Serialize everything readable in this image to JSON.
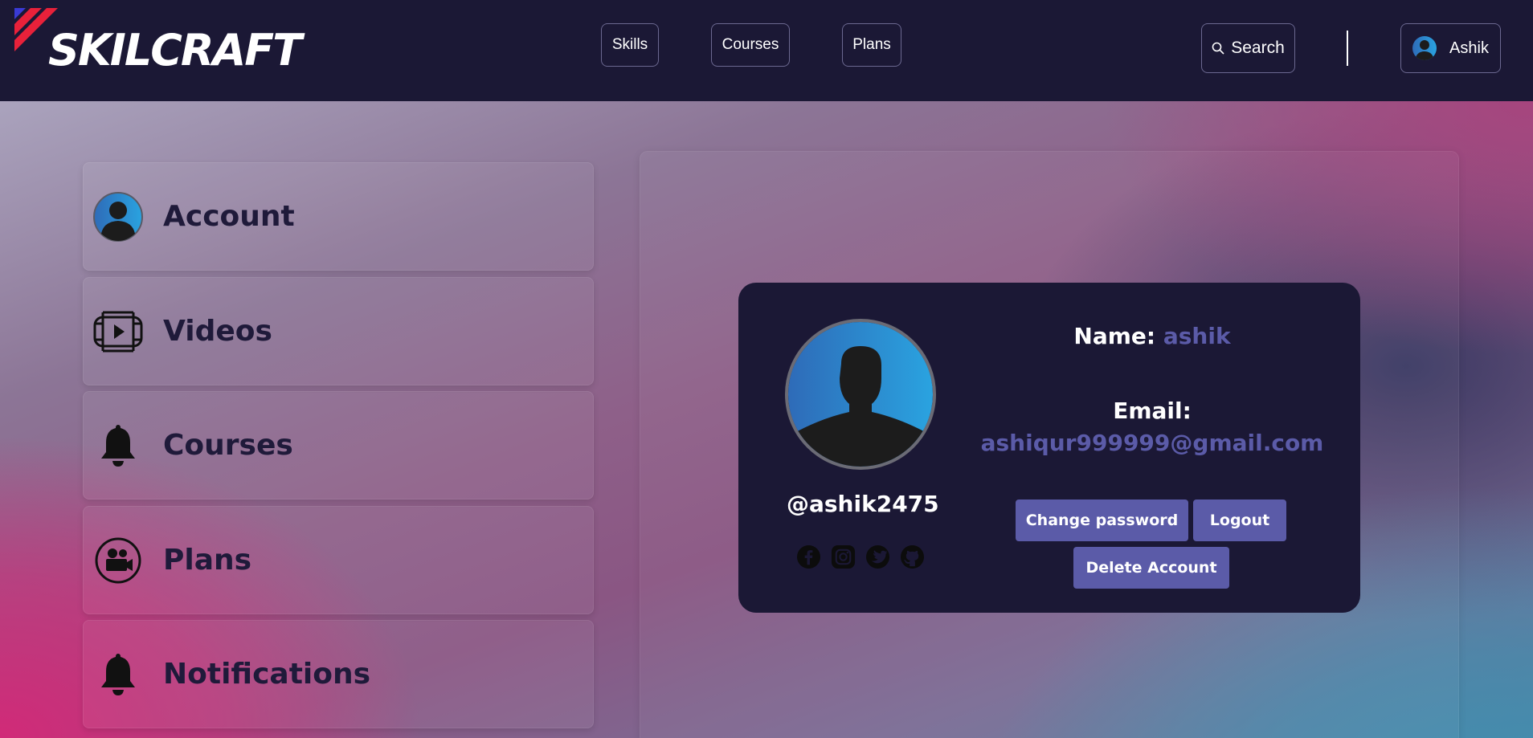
{
  "brand": {
    "name": "SKILCRAFT"
  },
  "header": {
    "nav": [
      {
        "label": "Skills"
      },
      {
        "label": "Courses"
      },
      {
        "label": "Plans"
      }
    ],
    "search_label": "Search",
    "user_name": "Ashik"
  },
  "sidebar": {
    "items": [
      {
        "label": "Account",
        "icon": "user-avatar-icon"
      },
      {
        "label": "Videos",
        "icon": "video-film-icon"
      },
      {
        "label": "Courses",
        "icon": "bell-icon"
      },
      {
        "label": "Plans",
        "icon": "camera-icon"
      },
      {
        "label": "Notifications",
        "icon": "bell-icon"
      }
    ]
  },
  "profile": {
    "handle": "@ashik2475",
    "name_label": "Name:",
    "name_value": "ashik",
    "email_label": "Email:",
    "email_value": "ashiqur999999@gmail.com",
    "socials": [
      "facebook-icon",
      "instagram-icon",
      "twitter-icon",
      "github-icon"
    ],
    "buttons": {
      "change_password": "Change password",
      "logout": "Logout",
      "delete_account": "Delete Account"
    }
  },
  "colors": {
    "header_bg": "#1b1835",
    "accent": "#5b5ba8",
    "sidebar_text": "#1f1a3a"
  }
}
